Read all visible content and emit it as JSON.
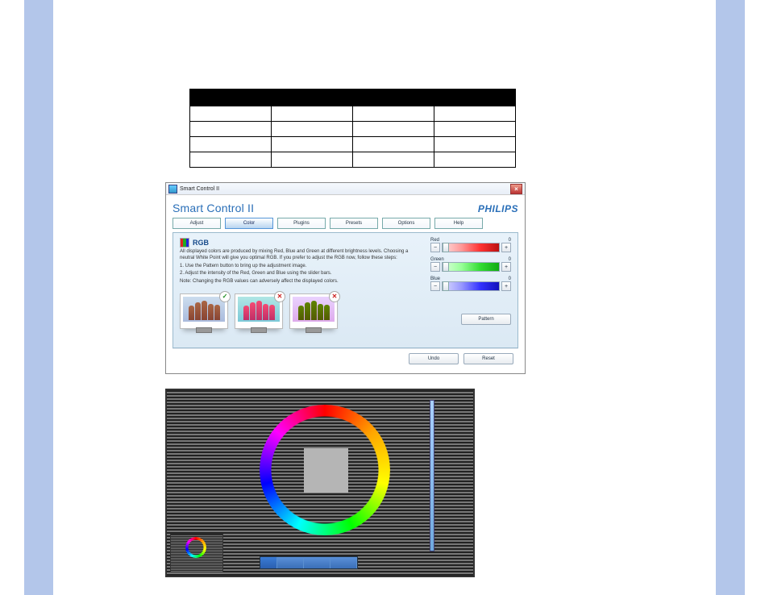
{
  "window": {
    "titlebar": "Smart Control II",
    "app_title": "Smart Control II",
    "brand": "PHILIPS"
  },
  "tabs": [
    {
      "label": "Adjust"
    },
    {
      "label": "Color"
    },
    {
      "label": "Plugins"
    },
    {
      "label": "Presets"
    },
    {
      "label": "Options"
    },
    {
      "label": "Help"
    }
  ],
  "rgb": {
    "title": "RGB",
    "desc1": "All displayed colors are produced by mixing Red, Blue and Green at different brightness levels. Choosing a neutral White Point will give you optimal RGB. If you prefer to adjust the RGB now, follow these steps:",
    "step1": "1. Use the Pattern button to bring up the adjustment image.",
    "step2": "2. Adjust the intensity of the Red, Green and Blue using the slider bars.",
    "note": "Note: Changing the RGB values can adversely affect the displayed colors."
  },
  "sliders": {
    "red": {
      "label": "Red",
      "value": "0"
    },
    "green": {
      "label": "Green",
      "value": "0"
    },
    "blue": {
      "label": "Blue",
      "value": "0"
    }
  },
  "buttons": {
    "pattern": "Pattern",
    "undo": "Undo",
    "reset": "Reset"
  }
}
